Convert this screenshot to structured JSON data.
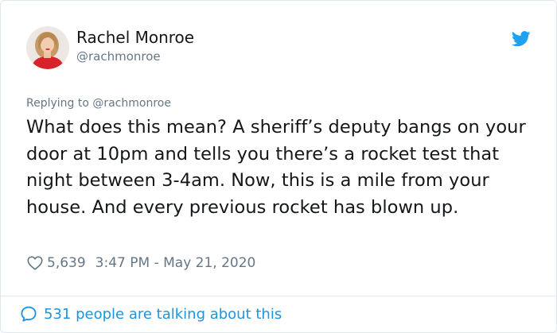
{
  "author": {
    "display_name": "Rachel Monroe",
    "handle": "@rachmonroe"
  },
  "reply_context": "Replying to @rachmonroe",
  "tweet": {
    "text": "What does this mean? A sheriff’s deputy bangs on your door at 10pm and tells you there’s a rocket test that night between 3-4am. Now, this is a mile from your house. And every previous rocket has blown up."
  },
  "meta": {
    "likes": "5,639",
    "timestamp": "3:47 PM - May 21, 2020"
  },
  "footer": {
    "talking_text": "531 people are talking about this"
  },
  "icons": {
    "brand": "twitter-bird-icon",
    "like": "heart-outline-icon",
    "conversation": "chat-bubble-icon"
  },
  "colors": {
    "accent": "#1da1f2",
    "link": "#1b95e0",
    "muted": "#657786",
    "text": "#14171a"
  }
}
